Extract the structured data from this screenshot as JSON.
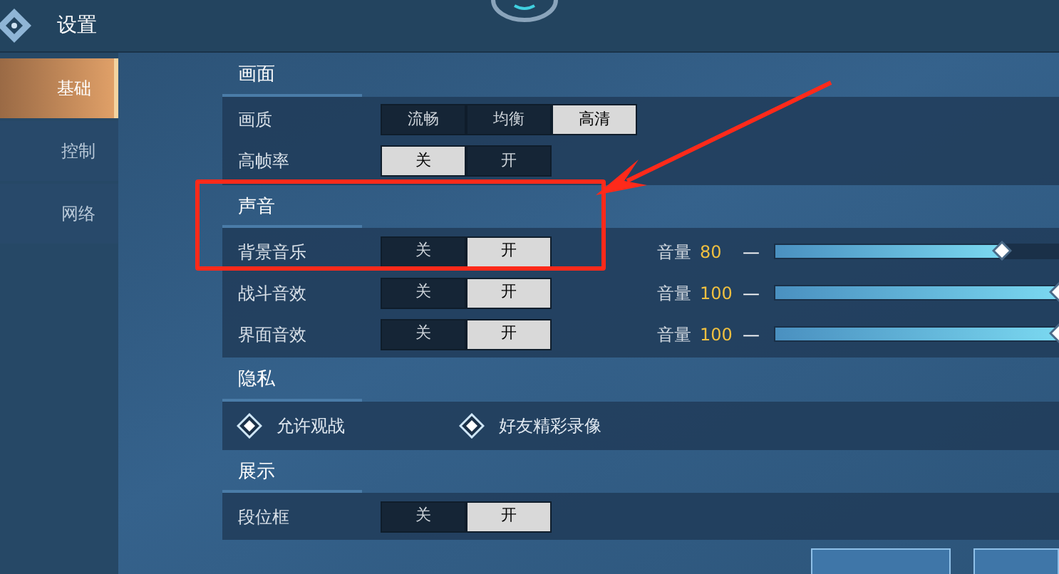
{
  "header": {
    "title": "设置"
  },
  "sidebar": {
    "items": [
      {
        "label": "基础",
        "selected": true
      },
      {
        "label": "控制",
        "selected": false
      },
      {
        "label": "网络",
        "selected": false
      }
    ]
  },
  "sections": [
    {
      "title": "画面",
      "rows": [
        {
          "kind": "segment",
          "label": "画质",
          "options": [
            {
              "label": "流畅",
              "selected": false
            },
            {
              "label": "均衡",
              "selected": false
            },
            {
              "label": "高清",
              "selected": true
            }
          ]
        },
        {
          "kind": "segment",
          "label": "高帧率",
          "options": [
            {
              "label": "关",
              "selected": true
            },
            {
              "label": "开",
              "selected": false
            }
          ]
        }
      ]
    },
    {
      "title": "声音",
      "rows": [
        {
          "kind": "segment",
          "label": "背景音乐",
          "options": [
            {
              "label": "关",
              "selected": false
            },
            {
              "label": "开",
              "selected": true
            }
          ],
          "volume": {
            "label": "音量",
            "value": "80",
            "minus": "—",
            "level": 0.8
          }
        },
        {
          "kind": "segment",
          "label": "战斗音效",
          "options": [
            {
              "label": "关",
              "selected": false
            },
            {
              "label": "开",
              "selected": true
            }
          ],
          "volume": {
            "label": "音量",
            "value": "100",
            "minus": "—",
            "level": 1
          }
        },
        {
          "kind": "segment",
          "label": "界面音效",
          "options": [
            {
              "label": "关",
              "selected": false
            },
            {
              "label": "开",
              "selected": true
            }
          ],
          "volume": {
            "label": "音量",
            "value": "100",
            "minus": "—",
            "level": 1
          }
        }
      ]
    },
    {
      "title": "隐私",
      "rows": [
        {
          "kind": "checks",
          "items": [
            {
              "label": "允许观战",
              "checked": true
            },
            {
              "label": "好友精彩录像",
              "checked": true
            }
          ]
        }
      ]
    },
    {
      "title": "展示",
      "rows": [
        {
          "kind": "segment",
          "label": "段位框",
          "options": [
            {
              "label": "关",
              "selected": false
            },
            {
              "label": "开",
              "selected": true
            }
          ]
        }
      ]
    }
  ]
}
